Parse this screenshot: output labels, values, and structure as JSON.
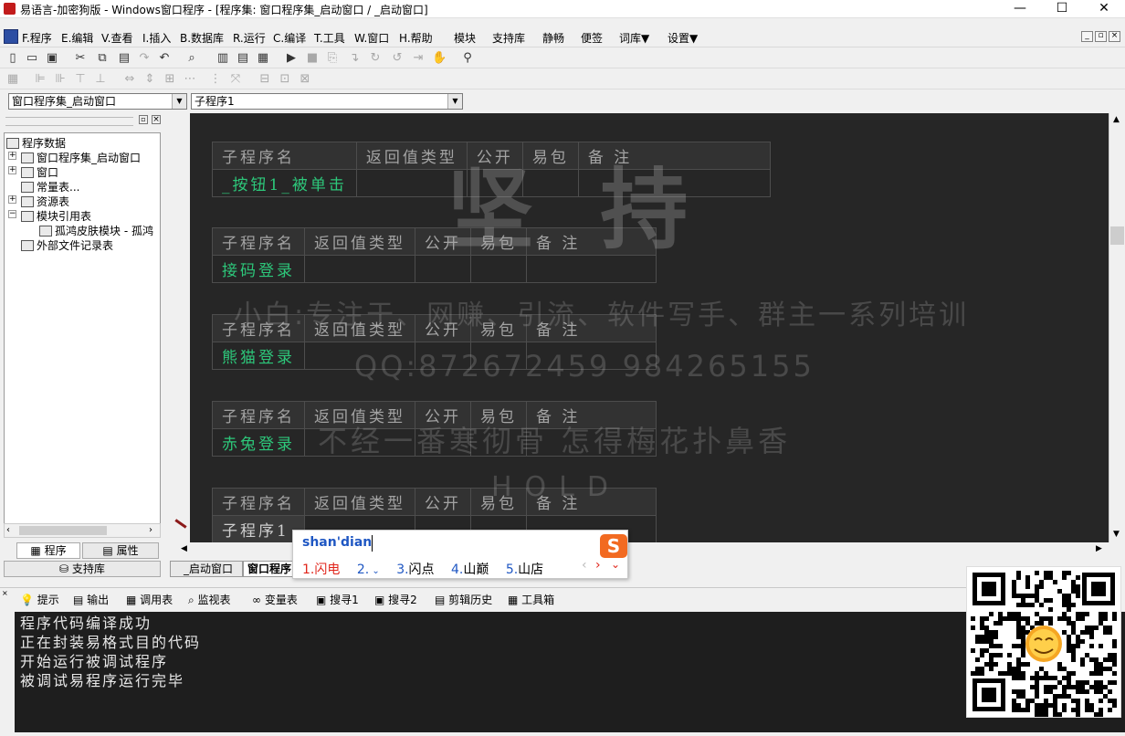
{
  "window": {
    "title": "易语言-加密狗版 - Windows窗口程序 - [程序集: 窗口程序集_启动窗口 / _启动窗口]",
    "minimize": "—",
    "maximize": "☐",
    "close": "✕"
  },
  "menu": {
    "items": [
      "F.程序",
      "E.编辑",
      "V.查看",
      "I.插入",
      "B.数据库",
      "R.运行",
      "C.编译",
      "T.工具",
      "W.窗口",
      "H.帮助",
      "模块",
      "支持库",
      "静畅",
      "便签",
      "词库▼",
      "设置▼"
    ]
  },
  "toolbar": {
    "class_combo": "窗口程序集_启动窗口",
    "sub_combo": "子程序1"
  },
  "tree": {
    "root": "程序数据",
    "items": [
      "窗口程序集_启动窗口",
      "窗口",
      "常量表...",
      "资源表",
      "模块引用表",
      "孤鸿皮肤模块 - 孤鸿",
      "外部文件记录表"
    ]
  },
  "left_tabs": {
    "program": "程序",
    "property": "属性",
    "support": "支持库"
  },
  "headers": {
    "name": "子程序名",
    "ret": "返回值类型",
    "public": "公开",
    "easy": "易包",
    "note": "备 注"
  },
  "subs": [
    "_按钮1_被单击",
    "接码登录",
    "熊猫登录",
    "赤兔登录",
    "子程序1"
  ],
  "watermark": {
    "big": "坚 持",
    "line1": "小白:专注于、网赚、引流、软件写手、群主一系列培训",
    "line2": "QQ:872672459 984265155",
    "line3": "不经一番寒彻骨  怎得梅花扑鼻香",
    "line4": "HOLD"
  },
  "doc_tabs": [
    "_启动窗口",
    "窗口程序"
  ],
  "output_tabs": [
    "提示",
    "输出",
    "调用表",
    "监视表",
    "变量表",
    "搜寻1",
    "搜寻2",
    "剪辑历史",
    "工具箱"
  ],
  "output_lines": [
    "程序代码编译成功",
    "正在封装易格式目的代码",
    "开始运行被调试程序",
    "被调试易程序运行完毕"
  ],
  "ime": {
    "pinyin": "shan'dian",
    "candidates": [
      {
        "n": "1.",
        "t": "闪电"
      },
      {
        "n": "2.",
        "t": ""
      },
      {
        "n": "3.",
        "t": "闪点"
      },
      {
        "n": "4.",
        "t": "山巅"
      },
      {
        "n": "5.",
        "t": "山店"
      }
    ]
  }
}
